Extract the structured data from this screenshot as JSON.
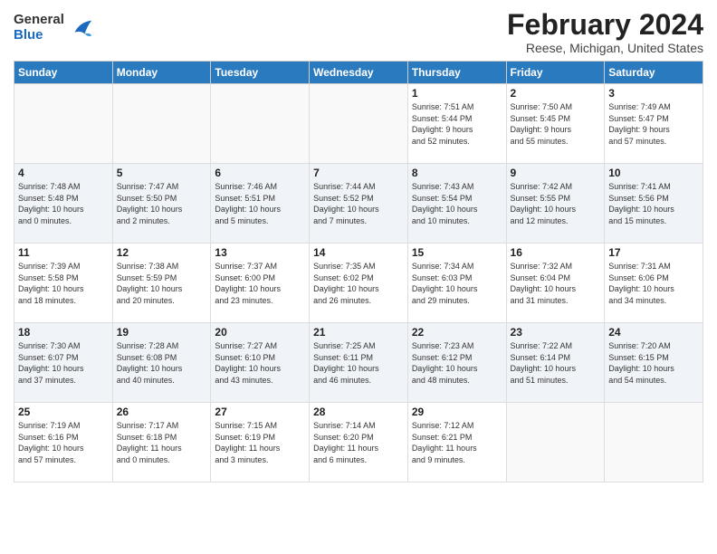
{
  "logo": {
    "general": "General",
    "blue": "Blue"
  },
  "header": {
    "month": "February 2024",
    "location": "Reese, Michigan, United States"
  },
  "days_of_week": [
    "Sunday",
    "Monday",
    "Tuesday",
    "Wednesday",
    "Thursday",
    "Friday",
    "Saturday"
  ],
  "weeks": [
    [
      {
        "day": "",
        "info": ""
      },
      {
        "day": "",
        "info": ""
      },
      {
        "day": "",
        "info": ""
      },
      {
        "day": "",
        "info": ""
      },
      {
        "day": "1",
        "info": "Sunrise: 7:51 AM\nSunset: 5:44 PM\nDaylight: 9 hours\nand 52 minutes."
      },
      {
        "day": "2",
        "info": "Sunrise: 7:50 AM\nSunset: 5:45 PM\nDaylight: 9 hours\nand 55 minutes."
      },
      {
        "day": "3",
        "info": "Sunrise: 7:49 AM\nSunset: 5:47 PM\nDaylight: 9 hours\nand 57 minutes."
      }
    ],
    [
      {
        "day": "4",
        "info": "Sunrise: 7:48 AM\nSunset: 5:48 PM\nDaylight: 10 hours\nand 0 minutes."
      },
      {
        "day": "5",
        "info": "Sunrise: 7:47 AM\nSunset: 5:50 PM\nDaylight: 10 hours\nand 2 minutes."
      },
      {
        "day": "6",
        "info": "Sunrise: 7:46 AM\nSunset: 5:51 PM\nDaylight: 10 hours\nand 5 minutes."
      },
      {
        "day": "7",
        "info": "Sunrise: 7:44 AM\nSunset: 5:52 PM\nDaylight: 10 hours\nand 7 minutes."
      },
      {
        "day": "8",
        "info": "Sunrise: 7:43 AM\nSunset: 5:54 PM\nDaylight: 10 hours\nand 10 minutes."
      },
      {
        "day": "9",
        "info": "Sunrise: 7:42 AM\nSunset: 5:55 PM\nDaylight: 10 hours\nand 12 minutes."
      },
      {
        "day": "10",
        "info": "Sunrise: 7:41 AM\nSunset: 5:56 PM\nDaylight: 10 hours\nand 15 minutes."
      }
    ],
    [
      {
        "day": "11",
        "info": "Sunrise: 7:39 AM\nSunset: 5:58 PM\nDaylight: 10 hours\nand 18 minutes."
      },
      {
        "day": "12",
        "info": "Sunrise: 7:38 AM\nSunset: 5:59 PM\nDaylight: 10 hours\nand 20 minutes."
      },
      {
        "day": "13",
        "info": "Sunrise: 7:37 AM\nSunset: 6:00 PM\nDaylight: 10 hours\nand 23 minutes."
      },
      {
        "day": "14",
        "info": "Sunrise: 7:35 AM\nSunset: 6:02 PM\nDaylight: 10 hours\nand 26 minutes."
      },
      {
        "day": "15",
        "info": "Sunrise: 7:34 AM\nSunset: 6:03 PM\nDaylight: 10 hours\nand 29 minutes."
      },
      {
        "day": "16",
        "info": "Sunrise: 7:32 AM\nSunset: 6:04 PM\nDaylight: 10 hours\nand 31 minutes."
      },
      {
        "day": "17",
        "info": "Sunrise: 7:31 AM\nSunset: 6:06 PM\nDaylight: 10 hours\nand 34 minutes."
      }
    ],
    [
      {
        "day": "18",
        "info": "Sunrise: 7:30 AM\nSunset: 6:07 PM\nDaylight: 10 hours\nand 37 minutes."
      },
      {
        "day": "19",
        "info": "Sunrise: 7:28 AM\nSunset: 6:08 PM\nDaylight: 10 hours\nand 40 minutes."
      },
      {
        "day": "20",
        "info": "Sunrise: 7:27 AM\nSunset: 6:10 PM\nDaylight: 10 hours\nand 43 minutes."
      },
      {
        "day": "21",
        "info": "Sunrise: 7:25 AM\nSunset: 6:11 PM\nDaylight: 10 hours\nand 46 minutes."
      },
      {
        "day": "22",
        "info": "Sunrise: 7:23 AM\nSunset: 6:12 PM\nDaylight: 10 hours\nand 48 minutes."
      },
      {
        "day": "23",
        "info": "Sunrise: 7:22 AM\nSunset: 6:14 PM\nDaylight: 10 hours\nand 51 minutes."
      },
      {
        "day": "24",
        "info": "Sunrise: 7:20 AM\nSunset: 6:15 PM\nDaylight: 10 hours\nand 54 minutes."
      }
    ],
    [
      {
        "day": "25",
        "info": "Sunrise: 7:19 AM\nSunset: 6:16 PM\nDaylight: 10 hours\nand 57 minutes."
      },
      {
        "day": "26",
        "info": "Sunrise: 7:17 AM\nSunset: 6:18 PM\nDaylight: 11 hours\nand 0 minutes."
      },
      {
        "day": "27",
        "info": "Sunrise: 7:15 AM\nSunset: 6:19 PM\nDaylight: 11 hours\nand 3 minutes."
      },
      {
        "day": "28",
        "info": "Sunrise: 7:14 AM\nSunset: 6:20 PM\nDaylight: 11 hours\nand 6 minutes."
      },
      {
        "day": "29",
        "info": "Sunrise: 7:12 AM\nSunset: 6:21 PM\nDaylight: 11 hours\nand 9 minutes."
      },
      {
        "day": "",
        "info": ""
      },
      {
        "day": "",
        "info": ""
      }
    ]
  ]
}
